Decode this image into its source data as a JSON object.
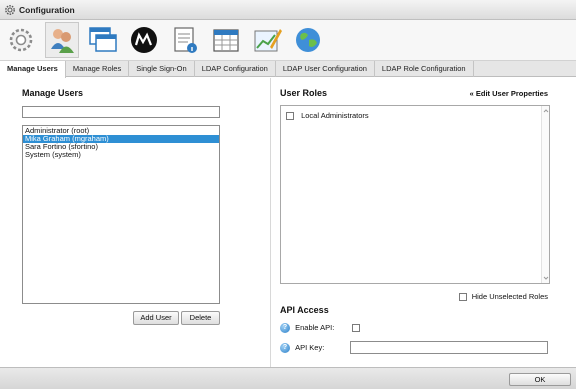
{
  "window": {
    "title": "Configuration"
  },
  "toolbar": {
    "tools": [
      {
        "icon": "gear-icon"
      },
      {
        "icon": "users-icon"
      },
      {
        "icon": "windows-icon"
      },
      {
        "icon": "m-logo-icon"
      },
      {
        "icon": "notepad-info-icon"
      },
      {
        "icon": "calendar-grid-icon"
      },
      {
        "icon": "chart-pen-icon"
      },
      {
        "icon": "globe-icon"
      }
    ]
  },
  "tabs": [
    {
      "label": "Manage Users",
      "active": true
    },
    {
      "label": "Manage Roles"
    },
    {
      "label": "Single Sign-On"
    },
    {
      "label": "LDAP Configuration"
    },
    {
      "label": "LDAP User Configuration"
    },
    {
      "label": "LDAP Role Configuration"
    }
  ],
  "manage_users": {
    "title": "Manage Users",
    "search_value": "",
    "users": [
      {
        "label": "Administrator (root)"
      },
      {
        "label": "Mika Graham (mgraham)",
        "selected": true
      },
      {
        "label": "Sara Fortino (sfortino)"
      },
      {
        "label": "System (system)"
      }
    ],
    "add_user_label": "Add User",
    "delete_label": "Delete"
  },
  "user_roles": {
    "title": "User Roles",
    "edit_link": "« Edit User Properties",
    "roles": [
      {
        "label": "Local Administrators",
        "checked": false
      }
    ],
    "hide_unselected_label": "Hide Unselected Roles"
  },
  "api_access": {
    "title": "API Access",
    "enable_label": "Enable API:",
    "key_label": "API Key:",
    "key_value": ""
  },
  "footer": {
    "ok_label": "OK"
  },
  "colors": {
    "selection": "#2e8fd4",
    "accent_link": "#111111"
  }
}
